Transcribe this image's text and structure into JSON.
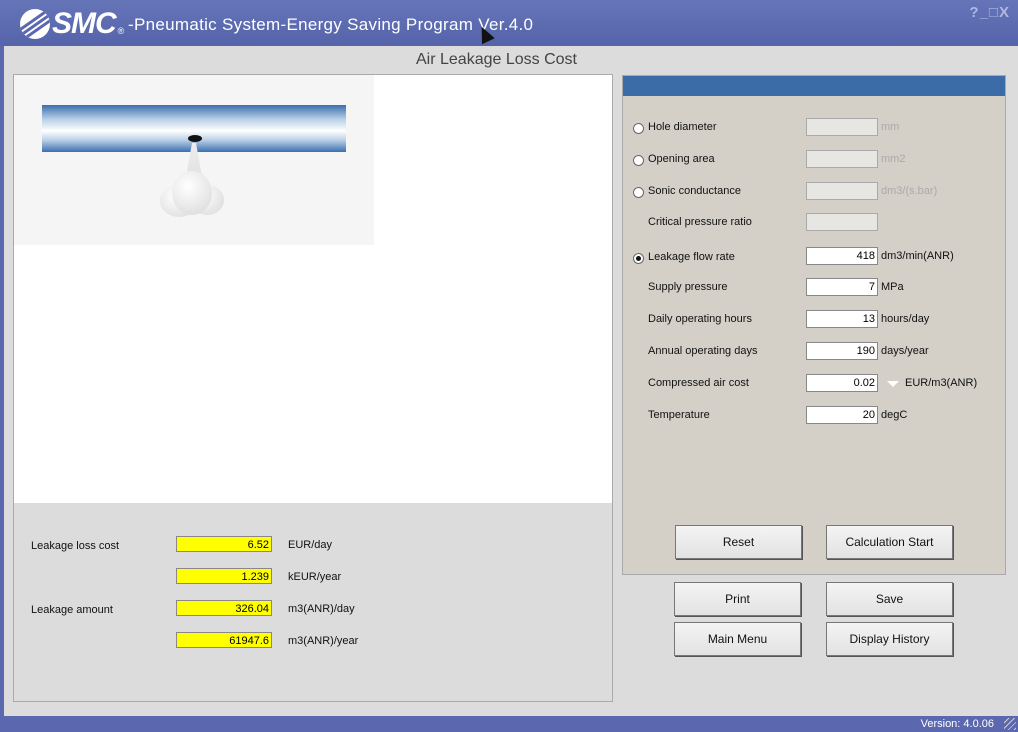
{
  "window": {
    "brand": "SMC",
    "title": "-Pneumatic System-Energy Saving Program Ver.4.0",
    "controls": "?_□X"
  },
  "page_title": "Air Leakage Loss Cost",
  "results": {
    "leakage_loss_cost_label": "Leakage loss cost",
    "leakage_amount_label": "Leakage amount",
    "rows": [
      {
        "value": "6.52",
        "unit": "EUR/day"
      },
      {
        "value": "1.239",
        "unit": "kEUR/year"
      },
      {
        "value": "326.04",
        "unit": "m3(ANR)/day"
      },
      {
        "value": "61947.6",
        "unit": "m3(ANR)/year"
      }
    ]
  },
  "params": {
    "hole_diameter": {
      "label": "Hole diameter",
      "value": "",
      "unit": "mm",
      "selected": false
    },
    "opening_area": {
      "label": "Opening area",
      "value": "",
      "unit": "mm2",
      "selected": false
    },
    "sonic_conductance": {
      "label": "Sonic conductance",
      "value": "",
      "unit": "dm3/(s.bar)",
      "selected": false
    },
    "critical_pressure_ratio": {
      "label": "Critical pressure ratio",
      "value": ""
    },
    "leakage_flow_rate": {
      "label": "Leakage flow rate",
      "value": "418",
      "unit": "dm3/min(ANR)",
      "selected": true
    },
    "supply_pressure": {
      "label": "Supply pressure",
      "value": "7",
      "unit": "MPa"
    },
    "daily_operating_hours": {
      "label": "Daily operating hours",
      "value": "13",
      "unit": "hours/day"
    },
    "annual_operating_days": {
      "label": "Annual operating days",
      "value": "190",
      "unit": "days/year"
    },
    "compressed_air_cost": {
      "label": "Compressed air cost",
      "value": "0.02",
      "unit": "EUR/m3(ANR)"
    },
    "temperature": {
      "label": "Temperature",
      "value": "20",
      "unit": "degC"
    }
  },
  "buttons": {
    "reset": "Reset",
    "calculation_start": "Calculation Start",
    "print": "Print",
    "save": "Save",
    "main_menu": "Main Menu",
    "display_history": "Display History"
  },
  "status": {
    "version": "Version: 4.0.06"
  },
  "colors": {
    "frame": "#5b68b0",
    "result_highlight": "#ffff00",
    "panel_header": "#3c6ca8"
  }
}
